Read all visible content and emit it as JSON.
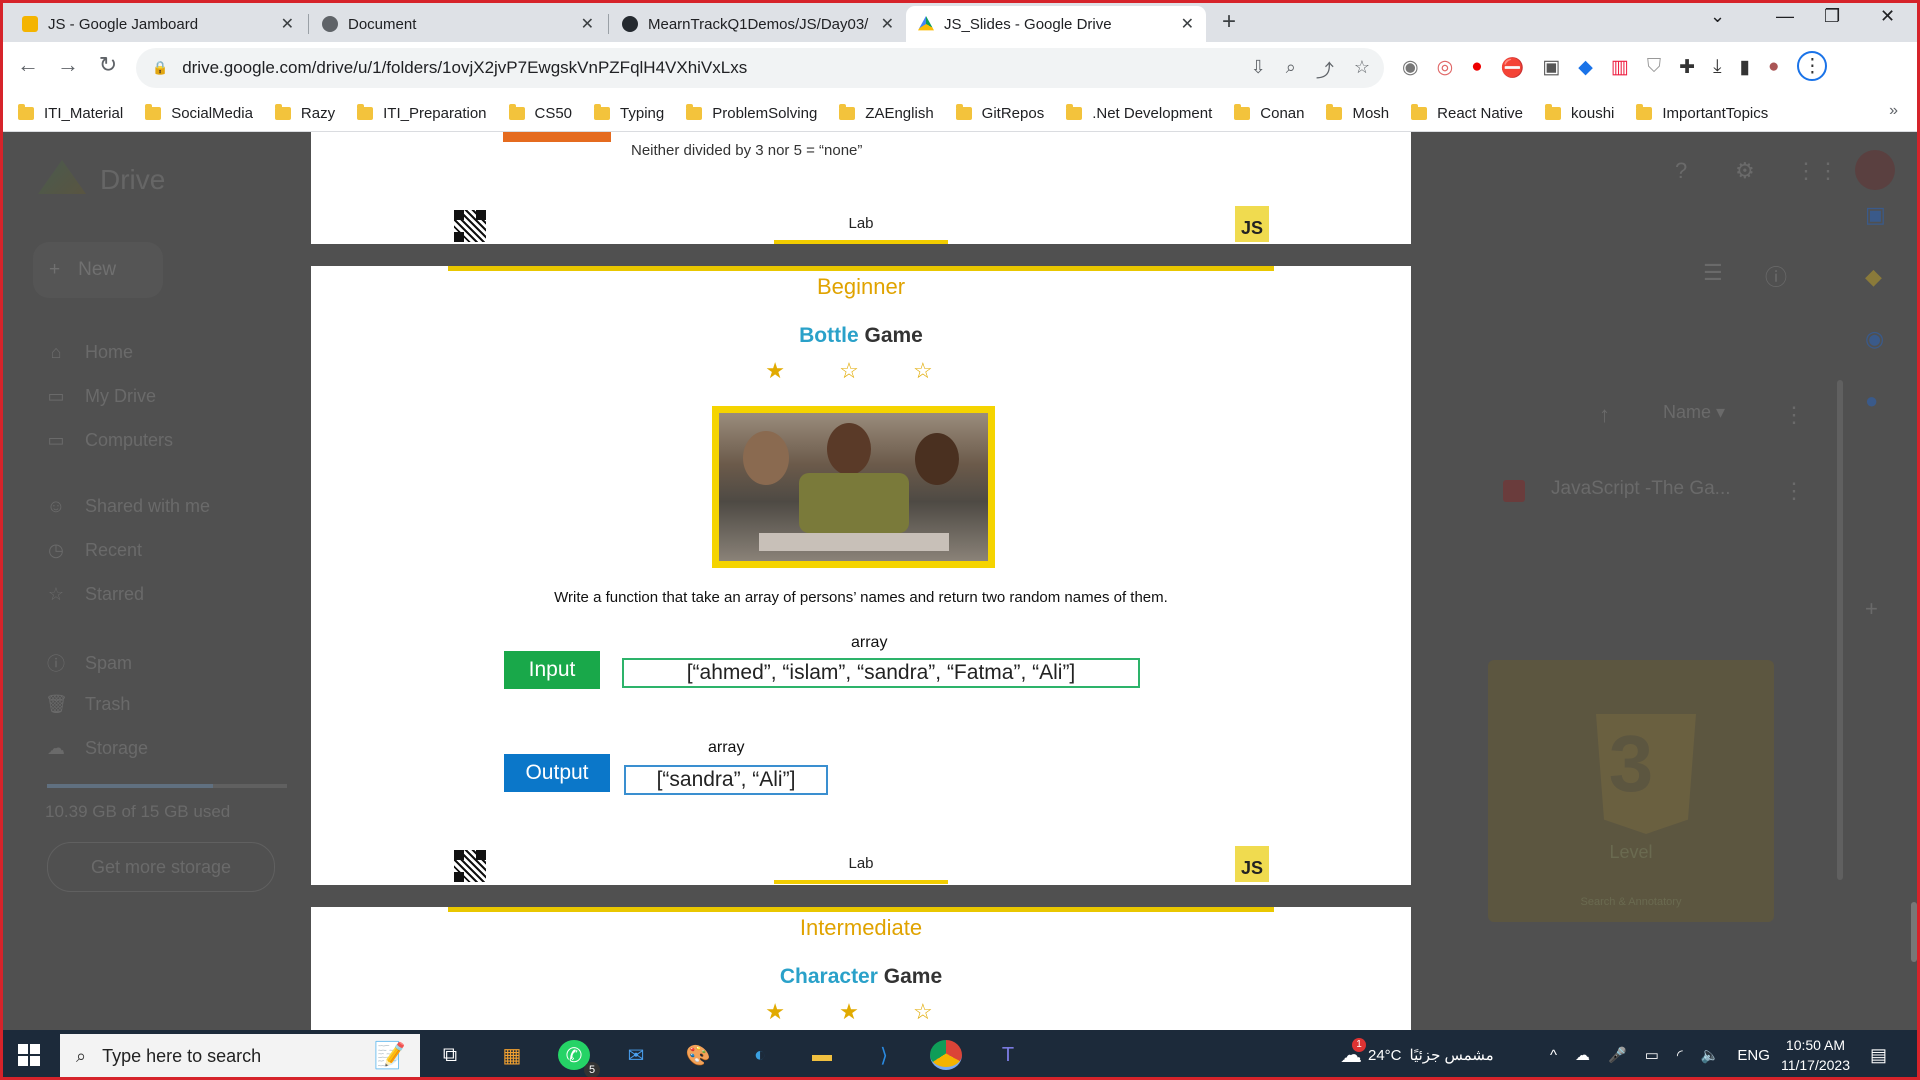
{
  "tabs": [
    {
      "title": "JS - Google Jamboard",
      "active": false
    },
    {
      "title": "Document",
      "active": false
    },
    {
      "title": "MearnTrackQ1Demos/JS/Day03/",
      "active": false
    },
    {
      "title": "JS_Slides - Google Drive",
      "active": true
    }
  ],
  "url": "drive.google.com/drive/u/1/folders/1ovjX2jvP7EwgskVnPZFqlH4VXhiVxLxs",
  "bookmarks": [
    "ITI_Material",
    "SocialMedia",
    "Razy",
    "ITI_Preparation",
    "CS50",
    "Typing",
    "ProblemSolving",
    "ZAEnglish",
    "GitRepos",
    ".Net Development",
    "Conan",
    "Mosh",
    "React Native",
    "koushi",
    "ImportantTopics"
  ],
  "drive": {
    "logo": "Drive",
    "new_label": "New",
    "nav": [
      "Home",
      "My Drive",
      "Computers",
      "Shared with me",
      "Recent",
      "Starred",
      "Spam",
      "Trash",
      "Storage"
    ],
    "storage_text": "10.39 GB of 15 GB used",
    "storage_fraction": 0.69,
    "get_more": "Get more storage",
    "sort_label": "Name",
    "file_name": "JavaScript -The Ga...",
    "file_thumb_num": "3",
    "file_thumb_sub": "Search & Annotatory",
    "file_thumb_level": "Level"
  },
  "slide_prev": {
    "line1": "Neither divided by 3 nor 5 = “none”",
    "footer": "Lab",
    "badge": "JS"
  },
  "slide_main": {
    "level": "Beginner",
    "title_colored": "Bottle",
    "title_rest": "Game",
    "stars": "★ ☆ ☆",
    "task": "Write a function that take an array of persons’ names and return two random names of them.",
    "input_type": "array",
    "input_label": "Input",
    "input_value": "[“ahmed”, “islam”, “sandra”, “Fatma”, “Ali”]",
    "output_type": "array",
    "output_label": "Output",
    "output_value": "[“sandra”, “Ali”]",
    "footer": "Lab",
    "badge": "JS"
  },
  "slide_next": {
    "level": "Intermediate",
    "title_colored": "Character",
    "title_rest": "Game",
    "stars": "★ ★ ☆"
  },
  "taskbar": {
    "search_placeholder": "Type here to search",
    "whatsapp_badge": "5",
    "weather": "24°C",
    "weather_text": "مشمس جزئيًا",
    "weather_badge": "1",
    "lang": "ENG",
    "time": "10:50 AM",
    "date": "11/17/2023"
  },
  "colors": {
    "accent_yellow": "#f2cd00",
    "input_green": "#19a84a",
    "output_blue": "#0b77c9",
    "title_cyan": "#2aa1c9"
  }
}
